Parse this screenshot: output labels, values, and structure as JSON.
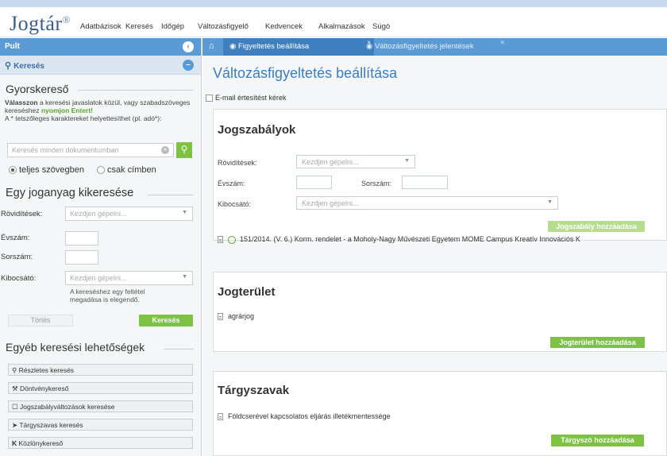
{
  "header": {
    "logo": "Jogtár",
    "logo_mark": "®",
    "nav": [
      "Adatbázisok",
      "Keresés",
      "Időgép",
      "Változásfigyelő",
      "Kedvencek",
      "Alkalmazások",
      "Súgó"
    ]
  },
  "sidebar": {
    "title": "Pult",
    "search_header": "Keresés",
    "quick": {
      "title": "Gyorskereső",
      "desc_bold1": "Válasszon",
      "desc1": " a keresési javaslatok közül, vagy szabadszöveges kereséshez ",
      "desc_green": "nyomjon Entert!",
      "desc2": "A * tetszőleges karaktereket helyettesíthet (pl. adó*):",
      "placeholder": "Keresés minden dokumentumban",
      "radio_full": "teljes szövegben",
      "radio_title": "csak címben"
    },
    "single": {
      "title": "Egy joganyag kikeresése",
      "abbr_label": "Rövidítések:",
      "abbr_placeholder": "Kezdjen gépelni...",
      "year_label": "Évszám:",
      "number_label": "Sorszám:",
      "issuer_label": "Kibocsátó:",
      "issuer_placeholder": "Kezdjen gépelni...",
      "hint": "A kereséshez egy feltétel megadása is elegendő.",
      "clear": "Törlés",
      "search": "Keresés"
    },
    "other": {
      "title": "Egyéb keresési lehetőségek",
      "items": [
        {
          "label": "Részletes keresés",
          "icon": "search-icon"
        },
        {
          "label": "Döntvénykereső",
          "icon": "gavel-icon"
        },
        {
          "label": "Jogszabályváltozások keresése",
          "icon": "calendar-icon"
        },
        {
          "label": "Tárgyszavas keresés",
          "icon": "tags-icon"
        },
        {
          "label": "Közlönykereső",
          "icon": "k-icon"
        }
      ]
    }
  },
  "tabs": [
    {
      "label": "Figyeltetés beállítása",
      "active": true
    },
    {
      "label": "Változásfigyeltetés jelentések",
      "active": false
    }
  ],
  "main": {
    "title": "Változásfigyeltetés beállítása",
    "email_label": "E-mail értesítést kérek",
    "jogszabalyok": {
      "title": "Jogszabályok",
      "abbr_label": "Rövidítések:",
      "abbr_placeholder": "Kezdjen gépelni...",
      "year_label": "Évszám:",
      "number_label": "Sorszám:",
      "issuer_label": "Kibocsátó:",
      "issuer_placeholder": "Kezdjen gépelni...",
      "add": "Jogszabály hozzáadása",
      "item": "151/2014. (V. 6.) Korm. rendelet - a Moholy-Nagy Művészeti Egyetem MOME Campus Kreatív Innovációs K"
    },
    "jogterulet": {
      "title": "Jogterület",
      "item": "agrárjog",
      "add": "Jogterület hozzáadása"
    },
    "targyszavak": {
      "title": "Tárgyszavak",
      "item": "Földcserével kapcsolatos eljárás illetékmentessége",
      "add": "Tárgyszó hozzáadása"
    }
  },
  "colors": {
    "accent": "#5b9bd5",
    "green": "#7dc242",
    "title_blue": "#3a7ebf"
  }
}
